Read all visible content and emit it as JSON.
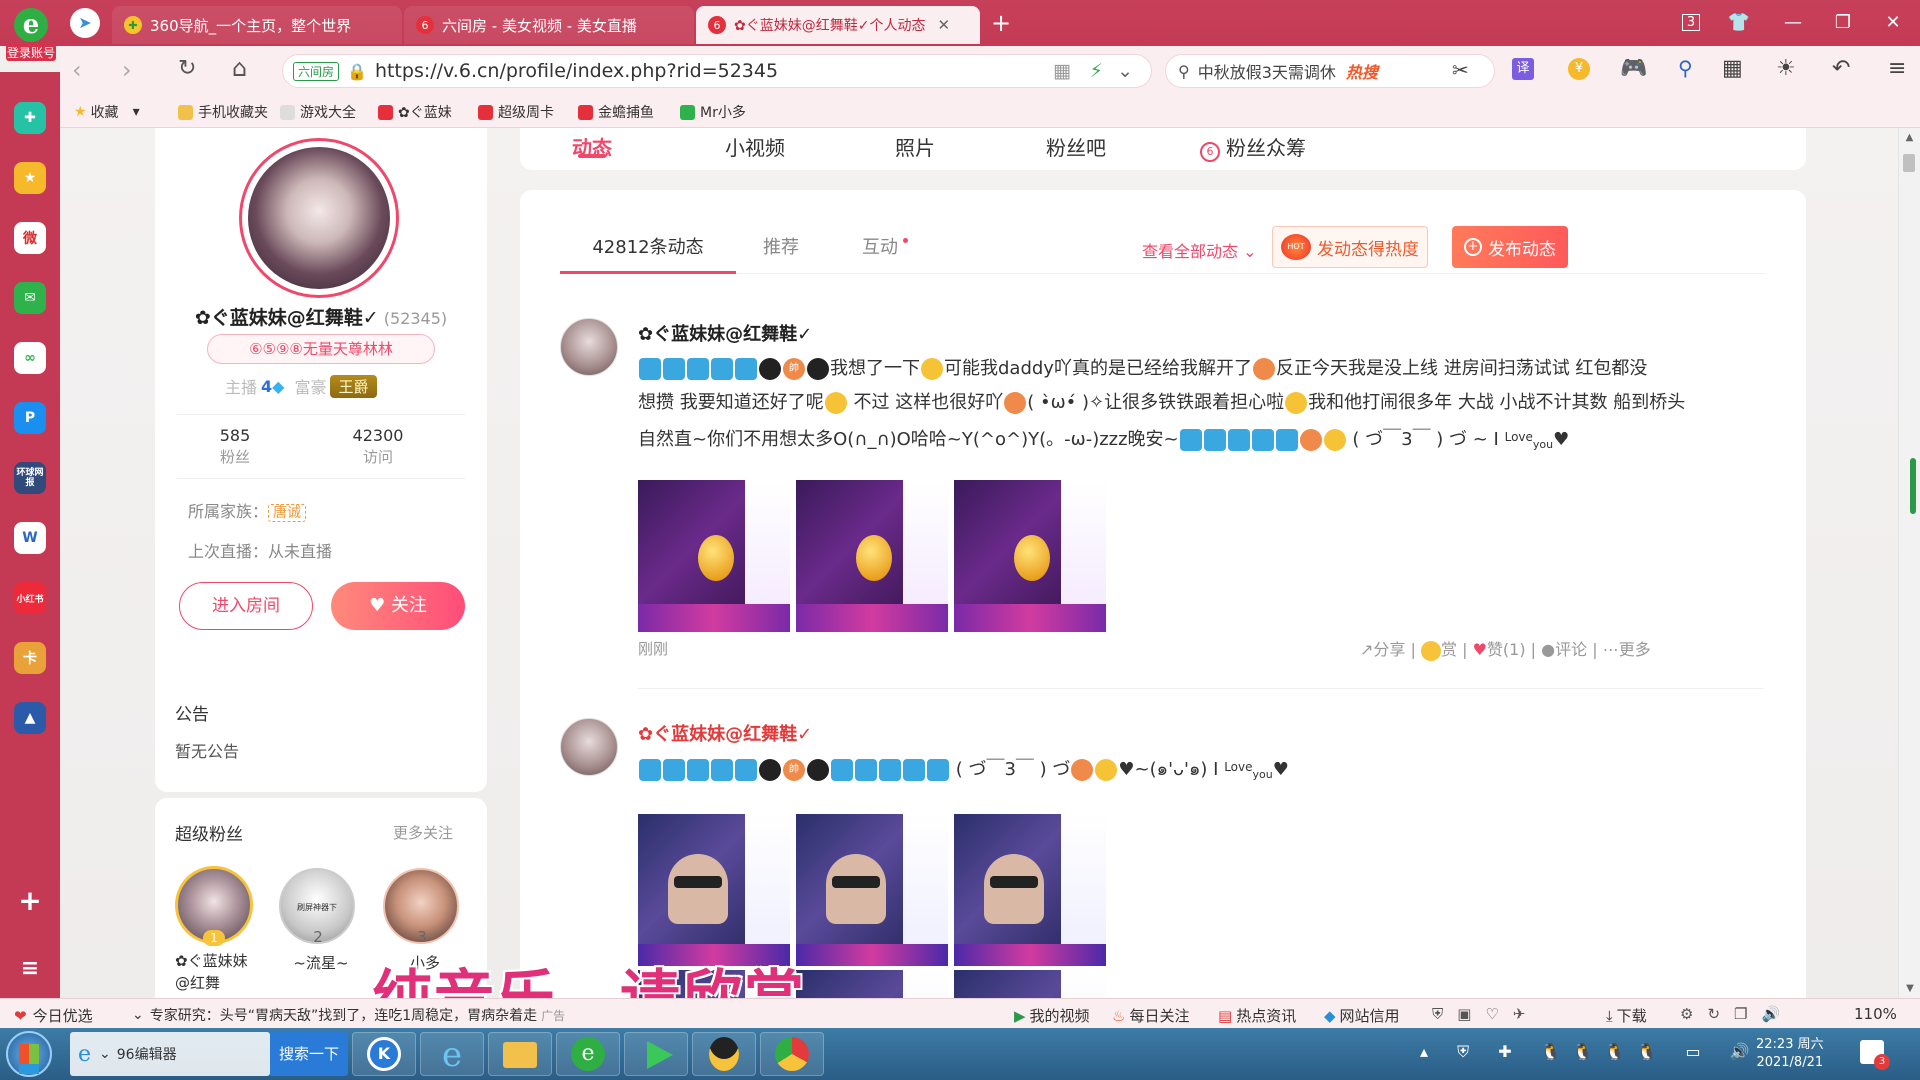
{
  "browser": {
    "logo_label": "登录账号",
    "tabs": [
      {
        "label": "360导航_一个主页，整个世界",
        "fav": "360"
      },
      {
        "label": "六间房 - 美女视频 - 美女直播",
        "fav": "6"
      },
      {
        "label": "✿ぐ蓝妹妹@红舞鞋✓个人动态",
        "fav": "6"
      }
    ],
    "tab_count": "3",
    "url_prefix": "六间房",
    "url": "https://v.6.cn/profile/index.php?rid=52345",
    "search_text": "中秋放假3天需调休",
    "search_badge": "热搜",
    "translate_label": "译"
  },
  "bookmarks": [
    {
      "label": "收藏"
    },
    {
      "label": "手机收藏夹"
    },
    {
      "label": "游戏大全"
    },
    {
      "label": "✿ぐ蓝妹"
    },
    {
      "label": "超级周卡"
    },
    {
      "label": "金蟾捕鱼"
    },
    {
      "label": "Mr小多"
    }
  ],
  "sidebar_icons": [
    "plus-icon",
    "star-icon",
    "weibo-icon",
    "mail-icon",
    "note-icon",
    "p-icon",
    "news-icon",
    "word-icon",
    "xiaohongshu-icon",
    "game-icon",
    "castle-icon"
  ],
  "sidebar_labels": {
    "news": "环球网报",
    "xhs": "小红书"
  },
  "top_tabs": [
    "动态",
    "小视频",
    "照片",
    "粉丝吧",
    "粉丝众筹"
  ],
  "profile": {
    "name": "✿ぐ蓝妹妹@红舞鞋✓",
    "rid": "(52345)",
    "slogan": "⑥⑤⑨⑧无量天尊林林",
    "anchor_label": "主播",
    "anchor_level": "4",
    "rich_label": "富豪",
    "rich_badge": "王爵",
    "fans_count": "585",
    "fans_label": "粉丝",
    "visits_count": "42300",
    "visits_label": "访问",
    "family_label": "所属家族：",
    "family_badge": "唐诚",
    "last_live": "上次直播：从未直播",
    "enter_room": "进入房间",
    "follow": "关注"
  },
  "notice": {
    "title": "公告",
    "text": "暂无公告"
  },
  "superfans": {
    "title": "超级粉丝",
    "more": "更多关注",
    "items": [
      {
        "rank": "1",
        "name": "✿ぐ蓝妹妹@红舞"
      },
      {
        "rank": "2",
        "name": "~流星~",
        "avatar_text": "刷屏神器下"
      },
      {
        "rank": "3",
        "name": "小多"
      }
    ]
  },
  "feed": {
    "tabs": [
      "42812条动态",
      "推荐",
      "互动"
    ],
    "view_all": "查看全部动态",
    "hot_button": "发动态得热度",
    "hot_badge": "HOT",
    "publish_button": "发布动态",
    "posts": [
      {
        "author": "✿ぐ蓝妹妹@红舞鞋✓",
        "line1": "我想了一下",
        "text_a": "可能我daddy吖真的是已经给我解开了",
        "text_b": "反正今天我是没上线 进房间扫荡试试 红包都没",
        "text_c": "想攒 我要知道还好了呢",
        "text_d": "不过 这样也很好吖",
        "text_e": "( •̀ω•́ )✧让很多铁铁跟着担心啦",
        "text_f": "我和他打闹很多年 大战 小战不计其数 船到桥头",
        "text_g": "自然直~你们不用想太多O(∩_∩)O哈哈~Y(^o^)Y(。-ω-)zzz晚安~",
        "text_h": "( づ￣3￣ ) づ ~ I",
        "love": "Love",
        "you": "you",
        "time": "刚刚",
        "badge_text": "帥",
        "actions": {
          "share": "分享",
          "reward": "赏",
          "like": "赞(1)",
          "comment": "评论",
          "more": "更多"
        }
      },
      {
        "author": "✿ぐ蓝妹妹@红舞鞋✓",
        "badge_text": "帥",
        "text_a": "( づ￣3￣ ) づ",
        "text_b": "~(๑'ᴗ'๑) I",
        "love": "Love",
        "you": "you"
      }
    ]
  },
  "video_overlay": "纯音乐，请欣赏",
  "statusbar": {
    "left1": "今日优选",
    "left2": "专家研究：头号“胃病天敌”找到了，连吃1周稳定，胃病杂着走",
    "ad": "广告",
    "items": [
      "我的视频",
      "每日关注",
      "热点资讯",
      "网站信用"
    ],
    "download": "下载",
    "zoom": "110%"
  },
  "taskbar": {
    "editor": "96编辑器",
    "search_btn": "搜索一下",
    "time": "22:23 周六",
    "date": "2021/8/21",
    "notif_count": "3"
  }
}
